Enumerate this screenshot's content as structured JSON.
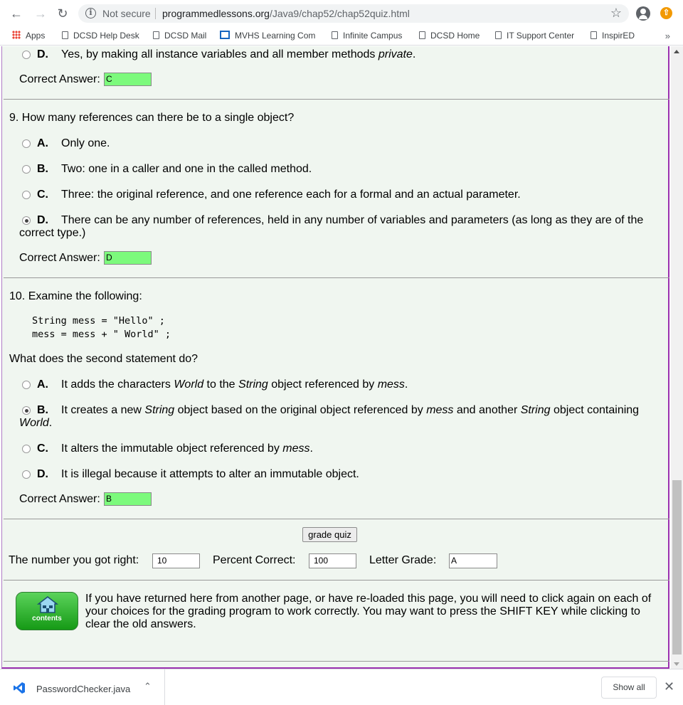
{
  "browser": {
    "security_label": "Not secure",
    "url_host": "programmedlessons.org",
    "url_path": "/Java9/chap52/chap52quiz.html",
    "bookmarks": {
      "apps": "Apps",
      "help_desk": "DCSD Help Desk",
      "mail": "DCSD Mail",
      "mvhs": "MVHS Learning Com",
      "infinite_campus": "Infinite Campus",
      "home": "DCSD Home",
      "it_support": "IT Support Center",
      "inspired": "InspirED",
      "more": "»"
    }
  },
  "q8": {
    "optD": {
      "letter": "D.",
      "text_pre": "Yes, by making all instance variables and all member methods ",
      "text_em": "private",
      "text_post": "."
    },
    "answer_label": "Correct Answer:",
    "answer_value": "C"
  },
  "q9": {
    "question": "9. How many references can there be to a single object?",
    "optA": {
      "letter": "A.",
      "text": "Only one."
    },
    "optB": {
      "letter": "B.",
      "text": "Two: one in a caller and one in the called method."
    },
    "optC": {
      "letter": "C.",
      "text": "Three: the original reference, and one reference each for a formal and an actual parameter."
    },
    "optD": {
      "letter": "D.",
      "text": "There can be any number of references, held in any number of variables and parameters (as long as they are of the",
      "text_cont": "correct type.)"
    },
    "answer_label": "Correct Answer:",
    "answer_value": "D"
  },
  "q10": {
    "question": "10. Examine the following:",
    "code_line1": "String mess = \"Hello\" ;",
    "code_line2": "mess = mess + \" World\" ;",
    "followup": "What does the second statement do?",
    "optA": {
      "letter": "A.",
      "t1": "It adds the characters ",
      "e1": "World",
      "t2": " to the ",
      "e2": "String",
      "t3": " object referenced by ",
      "e3": "mess",
      "t4": "."
    },
    "optB": {
      "letter": "B.",
      "t1": "It creates a new ",
      "e1": "String",
      "t2": " object based on the original object referenced by ",
      "e2": "mess",
      "t3": " and another ",
      "e3": "String",
      "t4": " object containing",
      "cont_em": "World",
      "cont_post": "."
    },
    "optC": {
      "letter": "C.",
      "t1": "It alters the immutable object referenced by ",
      "e1": "mess",
      "t2": "."
    },
    "optD": {
      "letter": "D.",
      "text": "It is illegal because it attempts to alter an immutable object."
    },
    "answer_label": "Correct Answer:",
    "answer_value": "B"
  },
  "grading": {
    "button_label": "grade quiz",
    "right_label": "The number you got right:",
    "right_value": "10",
    "percent_label": "Percent Correct:",
    "percent_value": "100",
    "grade_label": "Letter Grade:",
    "grade_value": "A"
  },
  "footer": {
    "contents_label": "contents",
    "note": "If you have returned here from another page, or have re-loaded this page, you will need to click again on each of your choices for the grading program to work correctly. You may want to press the SHIFT KEY while clicking to clear the old answers."
  },
  "downloads": {
    "file_name": "PasswordChecker.java",
    "show_all": "Show all"
  }
}
